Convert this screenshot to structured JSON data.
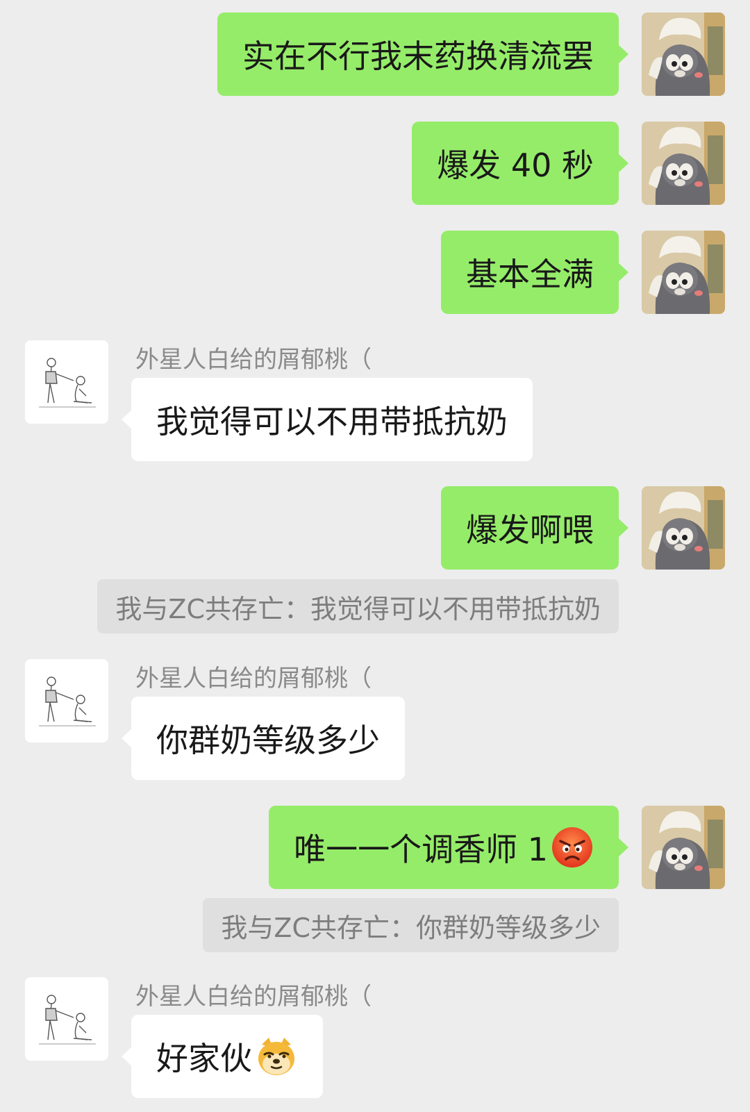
{
  "messages": [
    {
      "type": "self",
      "text": "实在不行我末药换清流罢"
    },
    {
      "type": "self",
      "text": "爆发 40 秒"
    },
    {
      "type": "self",
      "text": "基本全满"
    },
    {
      "type": "other",
      "sender": "外星人白给的屑郁桃（",
      "text": "我觉得可以不用带抵抗奶"
    },
    {
      "type": "self",
      "text": "爆发啊喂"
    },
    {
      "type": "quote",
      "text": "我与ZC共存亡：我觉得可以不用带抵抗奶"
    },
    {
      "type": "other",
      "sender": "外星人白给的屑郁桃（",
      "text": "你群奶等级多少"
    },
    {
      "type": "self",
      "text": "唯一一个调香师 1",
      "emoji": "angry-face-emoji"
    },
    {
      "type": "quote",
      "text": "我与ZC共存亡：你群奶等级多少"
    },
    {
      "type": "other",
      "sender": "外星人白给的屑郁桃（",
      "text": "好家伙",
      "emoji": "doge-emoji"
    }
  ],
  "colors": {
    "background": "#ededed",
    "self_bubble": "#95ec69",
    "other_bubble": "#ffffff",
    "quote_bg": "#dfdfdf"
  }
}
